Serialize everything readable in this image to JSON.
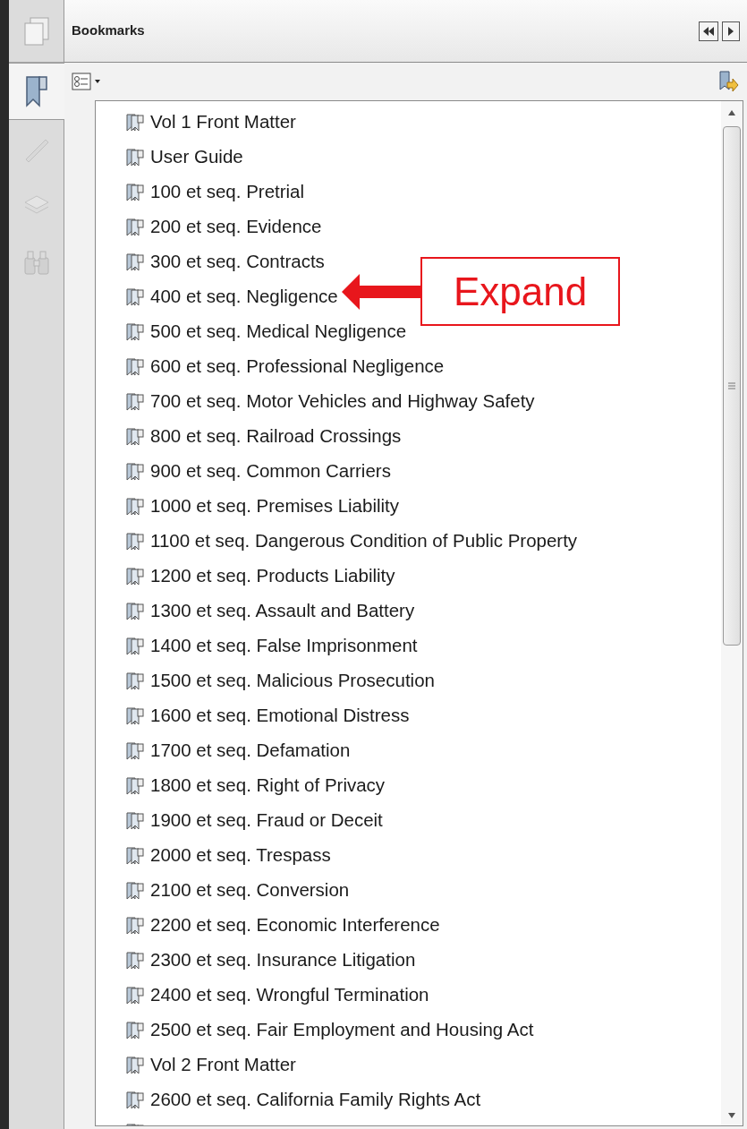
{
  "side_tabs": [
    {
      "kind": "pages",
      "selected": false
    },
    {
      "kind": "bookmarks",
      "selected": true
    },
    {
      "kind": "signatures",
      "selected": false
    },
    {
      "kind": "layers",
      "selected": false
    },
    {
      "kind": "attachments",
      "selected": false
    }
  ],
  "panel": {
    "title": "Bookmarks"
  },
  "bookmarks": [
    "Vol 1 Front Matter",
    "User Guide",
    "100 et seq. Pretrial",
    "200 et seq. Evidence",
    "300 et seq. Contracts",
    "400 et seq. Negligence",
    "500 et seq. Medical Negligence",
    "600 et seq. Professional Negligence",
    "700 et seq. Motor Vehicles and Highway Safety",
    "800 et seq. Railroad Crossings",
    "900 et seq. Common Carriers",
    "1000 et seq. Premises Liability",
    "1100 et seq. Dangerous Condition of Public Property",
    "1200 et seq. Products Liability",
    "1300 et seq. Assault and Battery",
    "1400 et seq. False Imprisonment",
    "1500 et seq. Malicious Prosecution",
    "1600 et seq. Emotional Distress",
    "1700 et seq. Defamation",
    "1800 et seq. Right of Privacy",
    "1900 et seq. Fraud or Deceit",
    "2000 et seq. Trespass",
    "2100 et seq. Conversion",
    "2200 et seq. Economic Interference",
    "2300 et seq. Insurance Litigation",
    "2400 et seq. Wrongful Termination",
    "2500 et seq. Fair Employment and Housing Act",
    "Vol 2 Front Matter",
    "2600 et seq. California Family Rights Act"
  ],
  "annotation": {
    "label": "Expand"
  }
}
